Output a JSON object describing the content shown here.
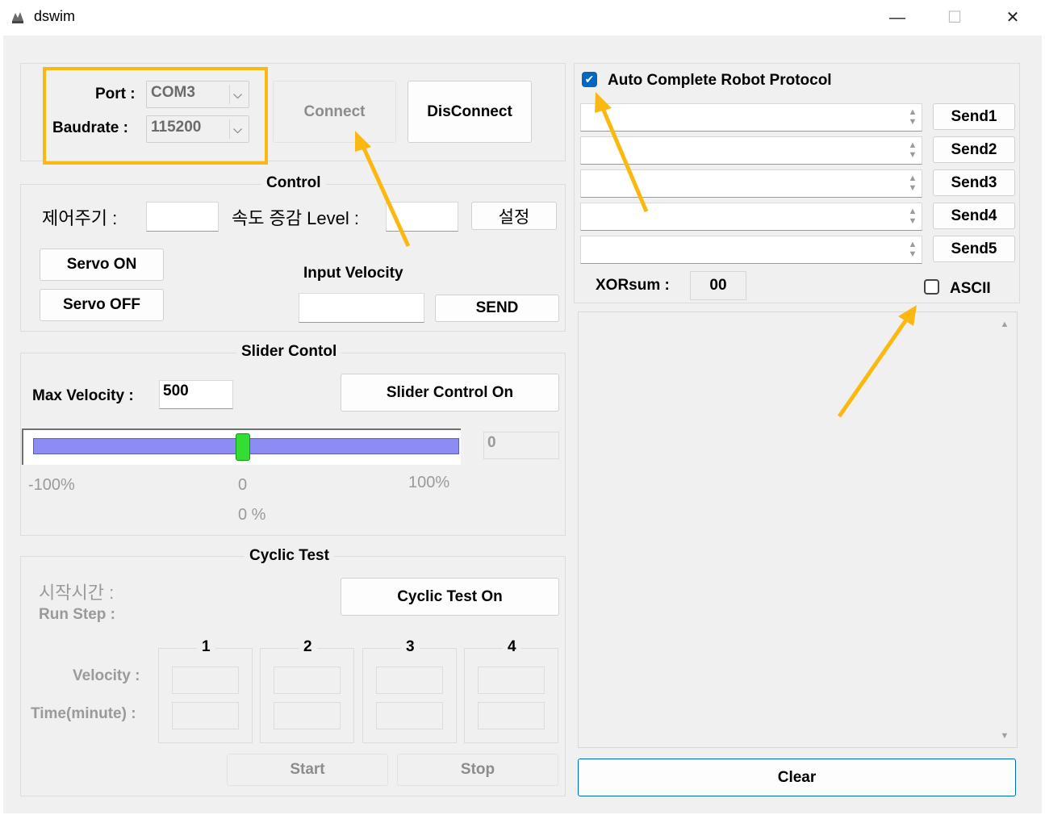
{
  "window": {
    "title": "dswim",
    "minimize": "—",
    "maximize": "☐",
    "close": "✕"
  },
  "connection": {
    "port_label": "Port :",
    "port_value": "COM3",
    "baud_label": "Baudrate :",
    "baud_value": "115200",
    "connect_label": "Connect",
    "disconnect_label": "DisConnect"
  },
  "control": {
    "title": "Control",
    "period_label": "제어주기 :",
    "period_value": "",
    "speed_label": "속도 증감 Level :",
    "speed_value": "",
    "set_label": "설정",
    "servo_on": "Servo ON",
    "servo_off": "Servo OFF",
    "input_velocity_label": "Input Velocity",
    "input_velocity_value": "",
    "send_label": "SEND"
  },
  "slider": {
    "title": "Slider Contol",
    "max_velocity_label": "Max Velocity :",
    "max_velocity_value": "500",
    "slider_control_label": "Slider Control On",
    "value_display": "0",
    "min_label": "-100%",
    "mid_label": "0",
    "max_label": "100%",
    "percent_label": "0 %",
    "position_fraction": 0.5
  },
  "cyclic": {
    "title": "Cyclic Test",
    "start_time_label": "시작시간 :",
    "run_step_label": "Run Step :",
    "button_label": "Cyclic Test On",
    "steps": [
      "1",
      "2",
      "3",
      "4"
    ],
    "velocity_label": "Velocity :",
    "time_label": "Time(minute) :",
    "start_label": "Start",
    "stop_label": "Stop"
  },
  "protocol": {
    "auto_complete_label": "Auto Complete Robot Protocol",
    "auto_complete_checked": true,
    "send_buttons": [
      "Send1",
      "Send2",
      "Send3",
      "Send4",
      "Send5"
    ],
    "xorsum_label": "XORsum :",
    "xorsum_value": "00",
    "ascii_label": "ASCII",
    "ascii_checked": false,
    "clear_label": "Clear"
  },
  "colors": {
    "accent": "#0067C0",
    "highlight": "#FBB810",
    "slider_track": "#8C8CF4",
    "slider_thumb": "#33DD33"
  }
}
